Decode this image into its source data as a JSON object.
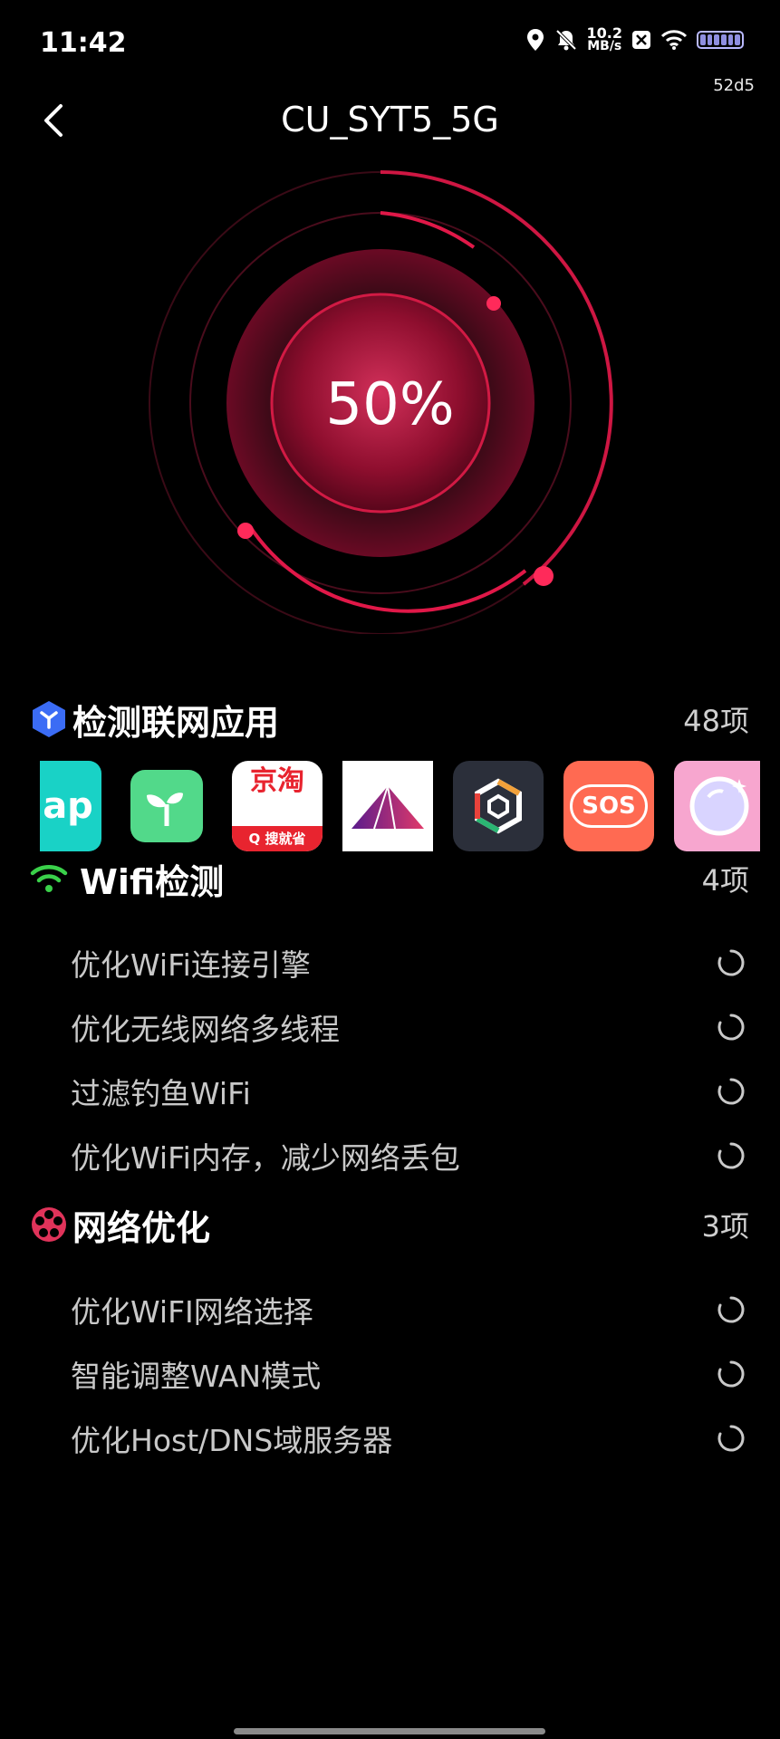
{
  "status_bar": {
    "time": "11:42",
    "speed_value": "10.2",
    "speed_unit": "MB/s",
    "sub_label": "52d5",
    "icons": [
      "location-icon",
      "mute-bell-icon",
      "close-badge-icon",
      "wifi-icon",
      "battery-icon"
    ]
  },
  "header": {
    "title": "CU_SYT5_5G"
  },
  "progress": {
    "label": "50%",
    "value": 0.5,
    "accent": "#e01848"
  },
  "apps_section": {
    "title": "检测联网应用",
    "count": "48项",
    "apps": [
      {
        "name": "taptap-app-icon",
        "label": "ap"
      },
      {
        "name": "sprout-app-icon",
        "label": ""
      },
      {
        "name": "jingtao-app-icon",
        "label": "京淘",
        "sub": "搜就省"
      },
      {
        "name": "mountain-app-icon",
        "label": ""
      },
      {
        "name": "hexagon-app-icon",
        "label": ""
      },
      {
        "name": "sos-app-icon",
        "label": "SOS"
      },
      {
        "name": "mirror-app-icon",
        "label": ""
      }
    ]
  },
  "wifi_section": {
    "title": "Wifi检测",
    "count": "4项",
    "items": [
      "优化WiFi连接引擎",
      "优化无线网络多线程",
      "过滤钓鱼WiFi",
      "优化WiFi内存，减少网络丢包"
    ]
  },
  "network_section": {
    "title": "网络优化",
    "count": "3项",
    "items": [
      "优化WiFI网络选择",
      "智能调整WAN模式",
      "优化Host/DNS域服务器"
    ]
  }
}
